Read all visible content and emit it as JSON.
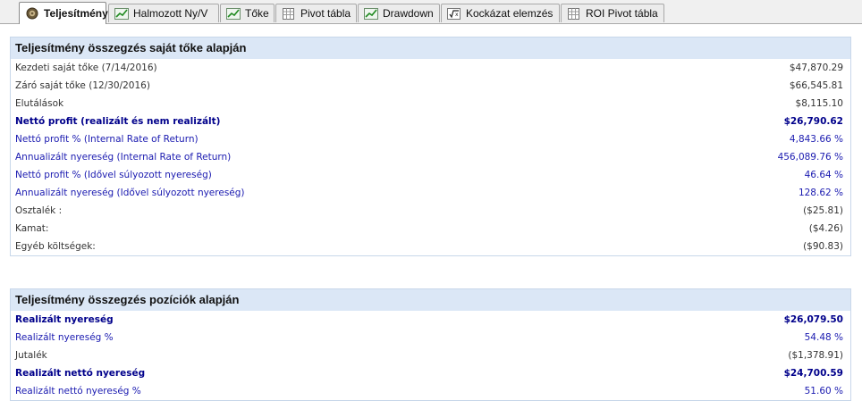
{
  "tabs": [
    {
      "label": "Teljesítmény",
      "icon": "performance-icon",
      "active": true
    },
    {
      "label": "Halmozott Ny/V",
      "icon": "chart-icon"
    },
    {
      "label": "Tőke",
      "icon": "chart-icon"
    },
    {
      "label": "Pivot tábla",
      "icon": "table-icon"
    },
    {
      "label": "Drawdown",
      "icon": "chart-icon"
    },
    {
      "label": "Kockázat elemzés",
      "icon": "sqrt-icon"
    },
    {
      "label": "ROI Pivot tábla",
      "icon": "table-icon"
    }
  ],
  "equity_summary": {
    "title": "Teljesítmény összegzés saját tőke alapján",
    "rows": [
      {
        "label": "Kezdeti saját tőke (7/14/2016)",
        "value": "$47,870.29",
        "style": "dark"
      },
      {
        "label": "Záró saját tőke (12/30/2016)",
        "value": "$66,545.81",
        "style": "dark"
      },
      {
        "label": "Elutálások",
        "value": "$8,115.10",
        "style": "dark"
      },
      {
        "label": "Nettó profit (realizált és nem realizált)",
        "value": "$26,790.62",
        "style": "bold"
      },
      {
        "label": "Nettó profit % (Internal Rate of Return)",
        "value": "4,843.66 %",
        "style": "blue"
      },
      {
        "label": "Annualizált nyereség (Internal Rate of Return)",
        "value": "456,089.76 %",
        "style": "blue"
      },
      {
        "label": "Nettó profit % (Idővel súlyozott nyereség)",
        "value": "46.64 %",
        "style": "blue"
      },
      {
        "label": "Annualizált nyereség (Idővel súlyozott nyereség)",
        "value": "128.62 %",
        "style": "blue"
      },
      {
        "label": "Osztalék :",
        "value": "($25.81)",
        "style": "dark"
      },
      {
        "label": "Kamat:",
        "value": "($4.26)",
        "style": "dark"
      },
      {
        "label": "Egyéb költségek:",
        "value": "($90.83)",
        "style": "dark"
      }
    ]
  },
  "position_summary": {
    "title": "Teljesítmény összegzés pozíciók alapján",
    "rows": [
      {
        "label": "Realizált nyereség",
        "value": "$26,079.50",
        "style": "bold"
      },
      {
        "label": "Realizált nyereség %",
        "value": "54.48 %",
        "style": "blue"
      },
      {
        "label": "Jutalék",
        "value": "($1,378.91)",
        "style": "dark"
      },
      {
        "label": "Realizált nettó nyereség",
        "value": "$24,700.59",
        "style": "bold"
      },
      {
        "label": "Realizált nettó nyereség %",
        "value": "51.60 %",
        "style": "blue"
      }
    ]
  }
}
